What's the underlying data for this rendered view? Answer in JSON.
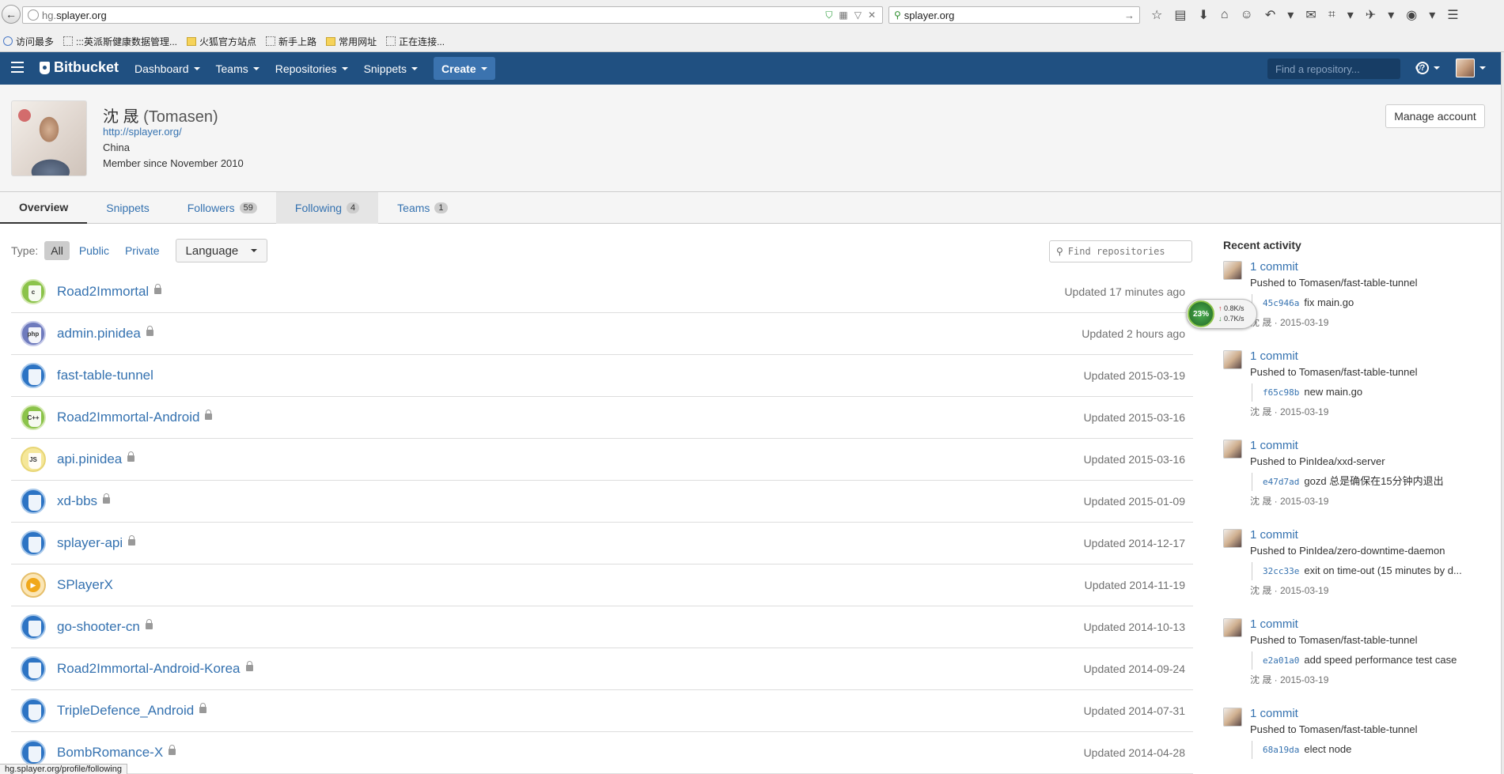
{
  "browser": {
    "url_host_prefix": "hg.",
    "url_host": "splayer.org",
    "search_value": "splayer.org",
    "bookmarks": [
      "访问最多",
      ":::英派斯健康数据管理...",
      "火狐官方站点",
      "新手上路",
      "常用网址",
      "正在连接..."
    ],
    "status_url": "hg.splayer.org/profile/following"
  },
  "header": {
    "logo": "Bitbucket",
    "nav": [
      "Dashboard",
      "Teams",
      "Repositories",
      "Snippets"
    ],
    "create": "Create",
    "search_placeholder": "Find a repository..."
  },
  "profile": {
    "name": "沈 晟",
    "username": "(Tomasen)",
    "website": "http://splayer.org/",
    "location": "China",
    "member_since": "Member since November 2010",
    "manage_label": "Manage account"
  },
  "tabs": [
    {
      "label": "Overview",
      "count": ""
    },
    {
      "label": "Snippets",
      "count": ""
    },
    {
      "label": "Followers",
      "count": "59"
    },
    {
      "label": "Following",
      "count": "4"
    },
    {
      "label": "Teams",
      "count": "1"
    }
  ],
  "filters": {
    "type_label": "Type:",
    "options": [
      "All",
      "Public",
      "Private"
    ],
    "language_label": "Language",
    "find_placeholder": "Find repositories"
  },
  "repos": [
    {
      "name": "Road2Immortal",
      "updated": "Updated 17 minutes ago",
      "icon": "c",
      "private": true
    },
    {
      "name": "admin.pinidea",
      "updated": "Updated 2 hours ago",
      "icon": "php",
      "private": true
    },
    {
      "name": "fast-table-tunnel",
      "updated": "Updated 2015-03-19",
      "icon": "",
      "private": false
    },
    {
      "name": "Road2Immortal-Android",
      "updated": "Updated 2015-03-16",
      "icon": "C++",
      "private": true
    },
    {
      "name": "api.pinidea",
      "updated": "Updated 2015-03-16",
      "icon": "JS",
      "private": true
    },
    {
      "name": "xd-bbs",
      "updated": "Updated 2015-01-09",
      "icon": "",
      "private": true
    },
    {
      "name": "splayer-api",
      "updated": "Updated 2014-12-17",
      "icon": "",
      "private": true
    },
    {
      "name": "SPlayerX",
      "updated": "Updated 2014-11-19",
      "icon": "▶",
      "private": false
    },
    {
      "name": "go-shooter-cn",
      "updated": "Updated 2014-10-13",
      "icon": "",
      "private": true
    },
    {
      "name": "Road2Immortal-Android-Korea",
      "updated": "Updated 2014-09-24",
      "icon": "",
      "private": true
    },
    {
      "name": "TripleDefence_Android",
      "updated": "Updated 2014-07-31",
      "icon": "",
      "private": true
    },
    {
      "name": "BombRomance-X",
      "updated": "Updated 2014-04-28",
      "icon": "",
      "private": true
    }
  ],
  "activity": {
    "title": "Recent activity",
    "items": [
      {
        "commit": "1 commit",
        "pushed": "Pushed to Tomasen/fast-table-tunnel",
        "hash": "45c946a",
        "msg": "fix main.go",
        "meta": "沈 晟 · 2015-03-19"
      },
      {
        "commit": "1 commit",
        "pushed": "Pushed to Tomasen/fast-table-tunnel",
        "hash": "f65c98b",
        "msg": "new main.go",
        "meta": "沈 晟 · 2015-03-19"
      },
      {
        "commit": "1 commit",
        "pushed": "Pushed to PinIdea/xxd-server",
        "hash": "e47d7ad",
        "msg": "gozd 总是确保在15分钟内退出",
        "meta": "沈 晟 · 2015-03-19"
      },
      {
        "commit": "1 commit",
        "pushed": "Pushed to PinIdea/zero-downtime-daemon",
        "hash": "32cc33e",
        "msg": "exit on time-out (15 minutes by d...",
        "meta": "沈 晟 · 2015-03-19"
      },
      {
        "commit": "1 commit",
        "pushed": "Pushed to Tomasen/fast-table-tunnel",
        "hash": "e2a01a0",
        "msg": "add speed performance test case",
        "meta": "沈 晟 · 2015-03-19"
      },
      {
        "commit": "1 commit",
        "pushed": "Pushed to Tomasen/fast-table-tunnel",
        "hash": "68a19da",
        "msg": "elect node",
        "meta": ""
      }
    ]
  },
  "speed_widget": {
    "percent": "23%",
    "up": "0.8K/s",
    "down": "0.7K/s"
  }
}
